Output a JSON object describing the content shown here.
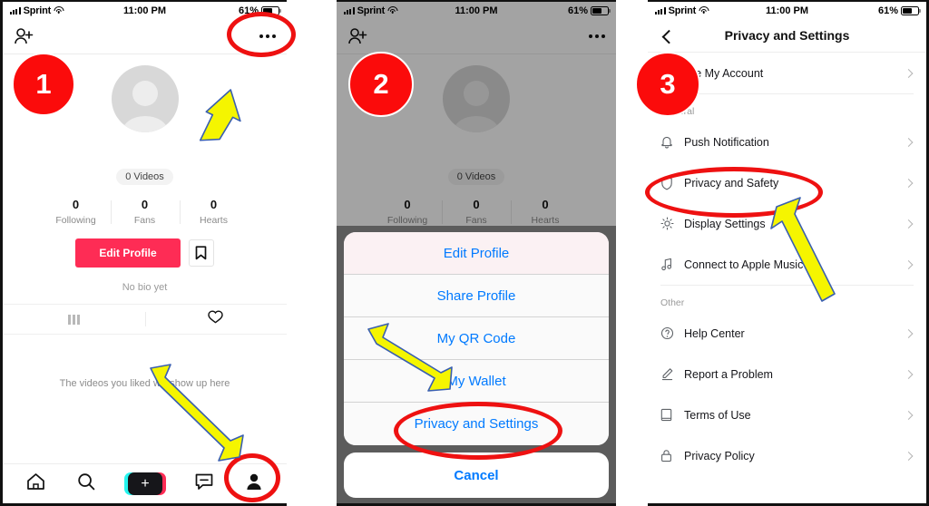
{
  "status_bar": {
    "carrier": "Sprint",
    "time": "11:00 PM",
    "battery": "61%"
  },
  "panels": [
    {
      "step": "1",
      "profile": {
        "videos_pill": "0 Videos",
        "stats": [
          {
            "num": "0",
            "label": "Following"
          },
          {
            "num": "0",
            "label": "Fans"
          },
          {
            "num": "0",
            "label": "Hearts"
          }
        ],
        "edit_profile": "Edit Profile",
        "bio": "No bio yet",
        "empty_liked": "The videos you liked will show up here"
      }
    },
    {
      "step": "2",
      "profile": {
        "videos_pill": "0 Videos",
        "stats": [
          {
            "num": "0",
            "label": "Following"
          },
          {
            "num": "0",
            "label": "Fans"
          },
          {
            "num": "0",
            "label": "Hearts"
          }
        ]
      },
      "action_sheet": {
        "items": [
          "Edit Profile",
          "Share Profile",
          "My QR Code",
          "My Wallet",
          "Privacy and Settings"
        ],
        "cancel": "Cancel"
      }
    },
    {
      "step": "3",
      "settings": {
        "title": "Privacy and Settings",
        "account_row": "Manage My Account",
        "sections": [
          {
            "header": "General",
            "rows": [
              {
                "icon": "bell-icon",
                "label": "Push Notification"
              },
              {
                "icon": "shield-icon",
                "label": "Privacy and Safety"
              },
              {
                "icon": "gear-icon",
                "label": "Display Settings"
              },
              {
                "icon": "music-icon",
                "label": "Connect to Apple Music"
              }
            ]
          },
          {
            "header": "Other",
            "rows": [
              {
                "icon": "question-icon",
                "label": "Help Center"
              },
              {
                "icon": "pencil-icon",
                "label": "Report a Problem"
              },
              {
                "icon": "book-icon",
                "label": "Terms of Use"
              },
              {
                "icon": "lock-icon",
                "label": "Privacy Policy"
              }
            ]
          }
        ]
      }
    }
  ],
  "colors": {
    "accent_red": "#fe2c55",
    "annotation_red": "#ee1111",
    "annotation_yellow": "#f5f500",
    "ios_blue": "#007aff"
  }
}
